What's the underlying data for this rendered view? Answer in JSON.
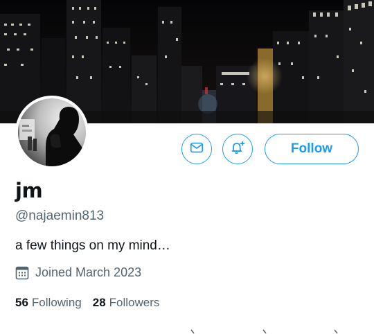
{
  "profile": {
    "display_name": "jm",
    "handle": "@najaemin813",
    "bio": "a few things on my mind…",
    "joined": "Joined March 2023"
  },
  "stats": {
    "following_count": "56",
    "following_label": "Following",
    "followers_count": "28",
    "followers_label": "Followers"
  },
  "actions": {
    "follow_label": "Follow",
    "message_icon": "envelope-icon",
    "notify_icon": "bell-plus-icon"
  },
  "icons": {
    "calendar": "calendar-icon"
  },
  "colors": {
    "accent": "#1d9bf0",
    "secondary_text": "#536471",
    "primary_text": "#0f1419"
  }
}
